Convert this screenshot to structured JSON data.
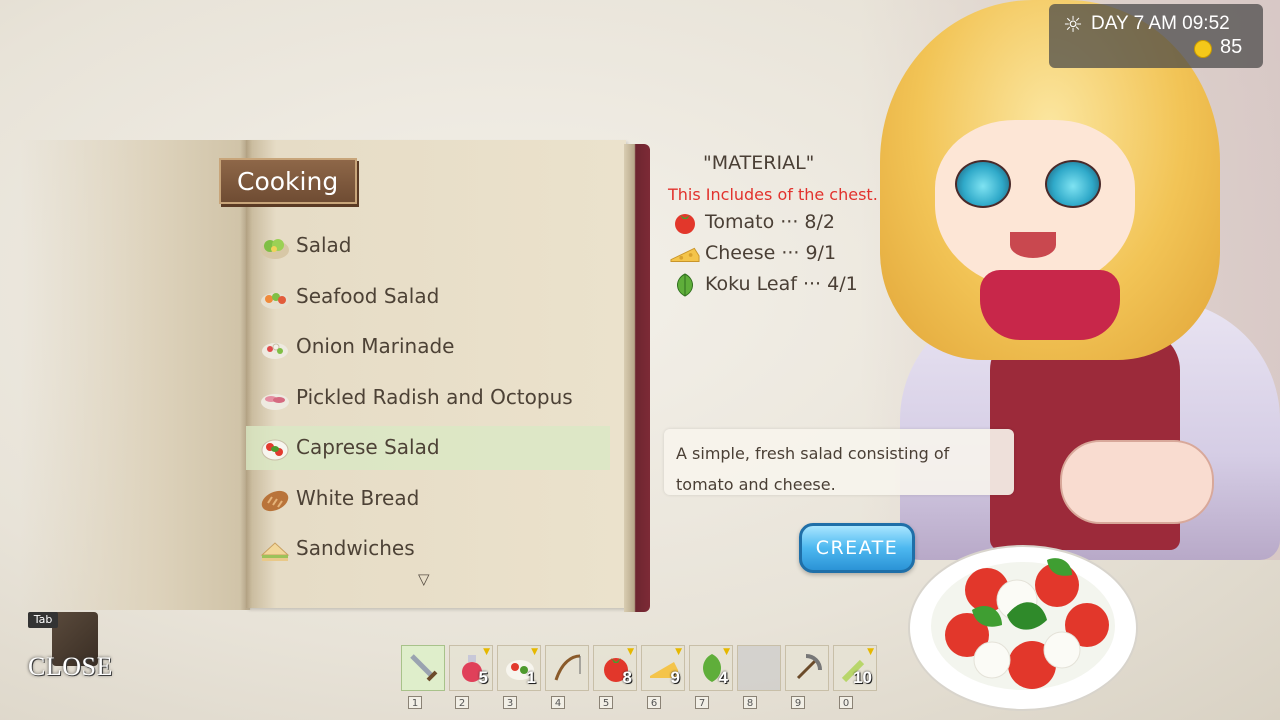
{
  "status": {
    "day_time": "DAY 7 AM 09:52",
    "gold": "85",
    "weather_icon": "sun-icon"
  },
  "book": {
    "title": "Cooking"
  },
  "recipes": [
    {
      "label": "Salad",
      "icon": "salad-icon"
    },
    {
      "label": "Seafood Salad",
      "icon": "seafood-salad-icon"
    },
    {
      "label": "Onion Marinade",
      "icon": "onion-marinade-icon"
    },
    {
      "label": "Pickled Radish and Octopus",
      "icon": "pickled-radish-icon"
    },
    {
      "label": "Caprese Salad",
      "icon": "caprese-salad-icon",
      "selected": true
    },
    {
      "label": "White Bread",
      "icon": "bread-icon"
    },
    {
      "label": "Sandwiches",
      "icon": "sandwich-icon"
    }
  ],
  "material": {
    "title": "\"MATERIAL\"",
    "chest_note": "This Includes of the chest.",
    "items": [
      {
        "label": "Tomato ··· 8/2",
        "icon": "tomato-icon"
      },
      {
        "label": "Cheese ··· 9/1",
        "icon": "cheese-icon"
      },
      {
        "label": "Koku Leaf ··· 4/1",
        "icon": "leaf-icon"
      }
    ]
  },
  "description": {
    "line1": "A simple, fresh salad consisting of",
    "line2": "tomato and cheese."
  },
  "create_label": "CREATE",
  "close": {
    "key": "Tab",
    "label": "CLOSE"
  },
  "hotbar": [
    {
      "num": "1",
      "icon": "sword-icon",
      "count": ""
    },
    {
      "num": "2",
      "icon": "potion-icon",
      "count": "5"
    },
    {
      "num": "3",
      "icon": "salad-icon",
      "count": "1"
    },
    {
      "num": "4",
      "icon": "fishing-rod-icon",
      "count": ""
    },
    {
      "num": "5",
      "icon": "tomato-icon",
      "count": "8"
    },
    {
      "num": "6",
      "icon": "cheese-icon",
      "count": "9"
    },
    {
      "num": "7",
      "icon": "leaf-icon",
      "count": "4"
    },
    {
      "num": "8",
      "icon": "empty-slot",
      "count": ""
    },
    {
      "num": "9",
      "icon": "pickaxe-icon",
      "count": ""
    },
    {
      "num": "0",
      "icon": "hoe-icon",
      "count": "10"
    }
  ]
}
